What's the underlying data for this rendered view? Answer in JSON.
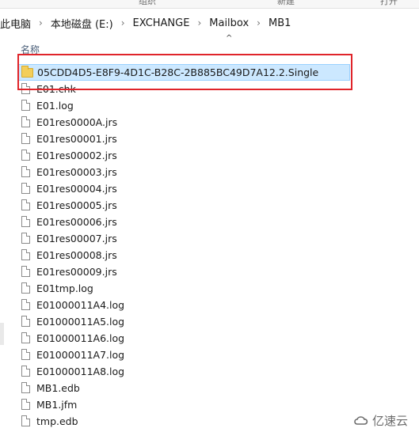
{
  "ribbon": {
    "labels": [
      "组织",
      "新建",
      "打开"
    ]
  },
  "breadcrumb": [
    "此电脑",
    "本地磁盘 (E:)",
    "EXCHANGE",
    "Mailbox",
    "MB1"
  ],
  "column_header": {
    "name_label": "名称"
  },
  "files": [
    {
      "name": "05CDD4D5-E8F9-4D1C-B28C-2B885BC49D7A12.2.Single",
      "type": "folder"
    },
    {
      "name": "E01.chk",
      "type": "file"
    },
    {
      "name": "E01.log",
      "type": "file"
    },
    {
      "name": "E01res0000A.jrs",
      "type": "file"
    },
    {
      "name": "E01res00001.jrs",
      "type": "file"
    },
    {
      "name": "E01res00002.jrs",
      "type": "file"
    },
    {
      "name": "E01res00003.jrs",
      "type": "file"
    },
    {
      "name": "E01res00004.jrs",
      "type": "file"
    },
    {
      "name": "E01res00005.jrs",
      "type": "file"
    },
    {
      "name": "E01res00006.jrs",
      "type": "file"
    },
    {
      "name": "E01res00007.jrs",
      "type": "file"
    },
    {
      "name": "E01res00008.jrs",
      "type": "file"
    },
    {
      "name": "E01res00009.jrs",
      "type": "file"
    },
    {
      "name": "E01tmp.log",
      "type": "file"
    },
    {
      "name": "E01000011A4.log",
      "type": "file"
    },
    {
      "name": "E01000011A5.log",
      "type": "file"
    },
    {
      "name": "E01000011A6.log",
      "type": "file"
    },
    {
      "name": "E01000011A7.log",
      "type": "file"
    },
    {
      "name": "E01000011A8.log",
      "type": "file"
    },
    {
      "name": "MB1.edb",
      "type": "file"
    },
    {
      "name": "MB1.jfm",
      "type": "file"
    },
    {
      "name": "tmp.edb",
      "type": "file"
    }
  ],
  "watermark": {
    "text": "亿速云"
  },
  "colors": {
    "highlight": "#e0242a",
    "selected": "#cce8ff"
  }
}
